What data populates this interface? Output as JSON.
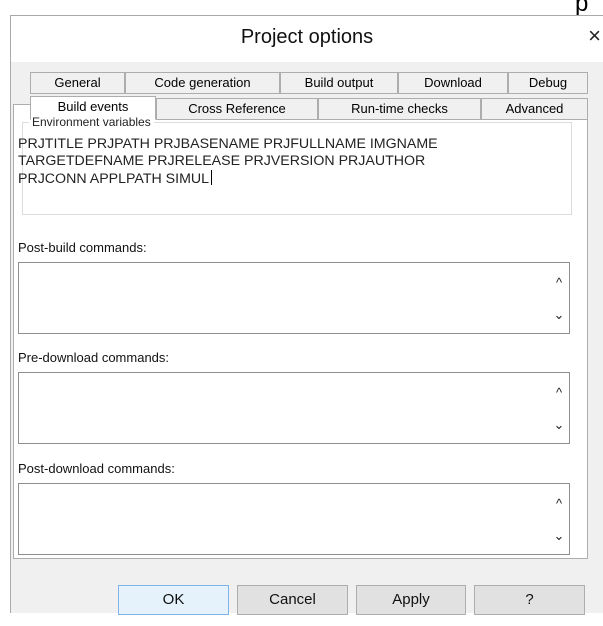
{
  "stray_char": "p",
  "dialog": {
    "title": "Project options",
    "close_glyph": "×"
  },
  "tabs_row1": [
    {
      "label": "General"
    },
    {
      "label": "Code generation"
    },
    {
      "label": "Build output"
    },
    {
      "label": "Download"
    },
    {
      "label": "Debug"
    }
  ],
  "tabs_row2": [
    {
      "label": "Build events",
      "active": true
    },
    {
      "label": "Cross Reference"
    },
    {
      "label": "Run-time checks"
    },
    {
      "label": "Advanced"
    }
  ],
  "env": {
    "legend": "Environment variables",
    "line1": "PRJTITLE PRJPATH PRJBASENAME PRJFULLNAME IMGNAME",
    "line2": "TARGETDEFNAME PRJRELEASE PRJVERSION PRJAUTHOR",
    "line3": "PRJCONN APPLPATH SIMUL"
  },
  "post_build": {
    "label": "Post-build commands:",
    "value": ""
  },
  "pre_download": {
    "label": "Pre-download commands:",
    "value": ""
  },
  "post_download": {
    "label": "Post-download commands:",
    "value": ""
  },
  "scroll": {
    "up": "^",
    "down": "⌄"
  },
  "buttons": {
    "ok": "OK",
    "cancel": "Cancel",
    "apply": "Apply",
    "help": "?"
  }
}
